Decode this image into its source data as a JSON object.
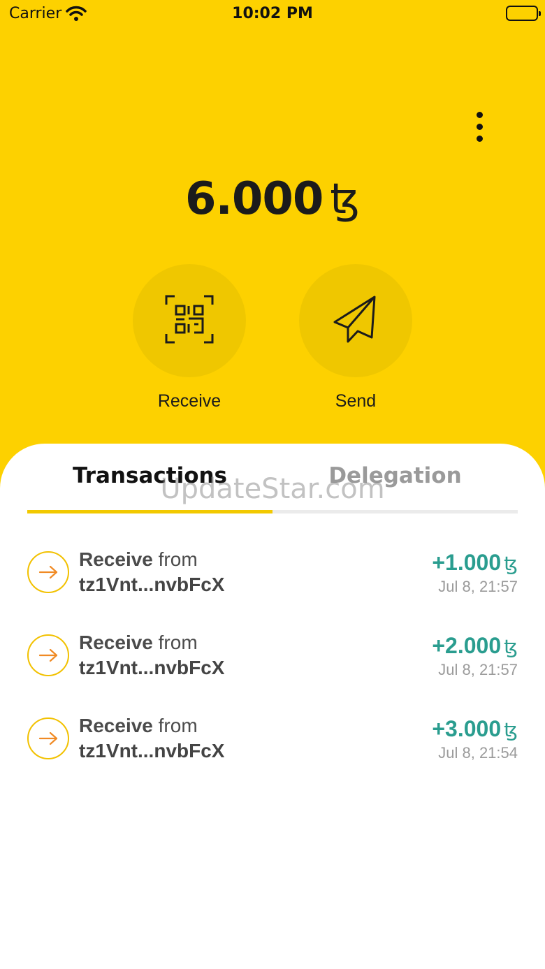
{
  "status_bar": {
    "carrier": "Carrier",
    "time": "10:02 PM"
  },
  "header": {
    "balance": "6.000",
    "currency_symbol": "ꜩ",
    "accent_color": "#FDD100",
    "more_icon": "more-vertical-icon"
  },
  "actions": [
    {
      "label": "Receive",
      "icon": "qr-scan-icon"
    },
    {
      "label": "Send",
      "icon": "paper-plane-icon"
    }
  ],
  "tabs": {
    "transactions": "Transactions",
    "delegation": "Delegation",
    "active": "Transactions"
  },
  "watermark": "UpdateStar.com",
  "transactions": [
    {
      "type": "Receive",
      "preposition": "from",
      "address": "tz1Vnt...nvbFcX",
      "amount": "+1.000",
      "symbol": "ꜩ",
      "time": "Jul 8, 21:57"
    },
    {
      "type": "Receive",
      "preposition": "from",
      "address": "tz1Vnt...nvbFcX",
      "amount": "+2.000",
      "symbol": "ꜩ",
      "time": "Jul 8, 21:57"
    },
    {
      "type": "Receive",
      "preposition": "from",
      "address": "tz1Vnt...nvbFcX",
      "amount": "+3.000",
      "symbol": "ꜩ",
      "time": "Jul 8, 21:54"
    }
  ],
  "colors": {
    "positive_amount": "#2a9d8f",
    "tab_indicator": "#F2C900"
  }
}
